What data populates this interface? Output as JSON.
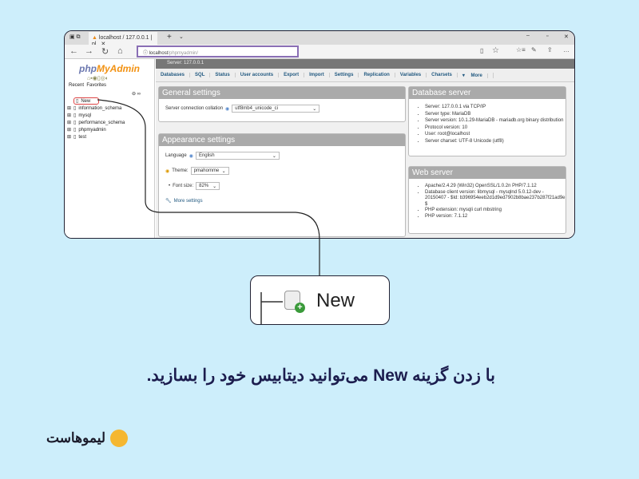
{
  "browser": {
    "tab_title": "localhost / 127.0.0.1 | pl",
    "url_host": "localhost",
    "url_path": "/phpmyadmin/"
  },
  "pma": {
    "logo_php": "php",
    "logo_myadmin": "MyAdmin",
    "recent": "Recent",
    "favorites": "Favorites",
    "tree": [
      "New",
      "information_schema",
      "mysql",
      "performance_schema",
      "phpmyadmin",
      "test"
    ],
    "server_bar": "Server: 127.0.0.1",
    "tabs": [
      "Databases",
      "SQL",
      "Status",
      "User accounts",
      "Export",
      "Import",
      "Settings",
      "Replication",
      "Variables",
      "Charsets",
      "More"
    ],
    "general": {
      "title": "General settings",
      "collation_label": "Server connection collation",
      "collation_value": "utf8mb4_unicode_ci"
    },
    "appearance": {
      "title": "Appearance settings",
      "language_label": "Language",
      "language_value": "English",
      "theme_label": "Theme:",
      "theme_value": "pmahomme",
      "font_label": "Font size:",
      "font_value": "82%",
      "more": "More settings"
    },
    "db_server": {
      "title": "Database server",
      "items": [
        "Server: 127.0.0.1 via TCP/IP",
        "Server type: MariaDB",
        "Server version: 10.1.29-MariaDB - mariadb.org binary distribution",
        "Protocol version: 10",
        "User: root@localhost",
        "Server charset: UTF-8 Unicode (utf8)"
      ]
    },
    "web_server": {
      "title": "Web server",
      "items": [
        "Apache/2.4.29 (Win32) OpenSSL/1.0.2n PHP/7.1.12",
        "Database client version: libmysql - mysqlnd 5.0.12-dev - 20150407 - $Id: b396954eeb2d1d9ed7902b8bae237b287f21ad9e $",
        "PHP extension: mysqli curl mbstring",
        "PHP version: 7.1.12"
      ]
    }
  },
  "callout": {
    "label": "New"
  },
  "caption": "با زدن گزینه New می‌توانید دیتابیس خود را بسازید.",
  "brand": {
    "name": "لیموهاست",
    "color": "#f5b731"
  }
}
